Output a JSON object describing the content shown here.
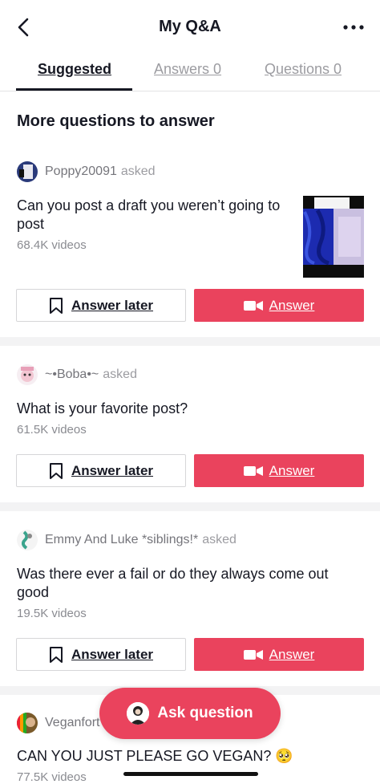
{
  "header": {
    "title": "My Q&A",
    "back_icon": "chevron-left-icon",
    "more_icon": "more-horizontal-icon"
  },
  "tabs": [
    {
      "label": "Suggested",
      "active": true
    },
    {
      "label": "Answers 0",
      "active": false
    },
    {
      "label": "Questions 0",
      "active": false
    }
  ],
  "section_title": "More questions to answer",
  "buttons": {
    "answer_later": "Answer later",
    "answer": "Answer"
  },
  "questions": [
    {
      "asker": "Poppy20091",
      "asked": "asked",
      "question": "Can you post a draft you weren’t going to post",
      "count": "68.4K videos"
    },
    {
      "asker": "~•Boba•~",
      "asked": "asked",
      "question": "What is your favorite post?",
      "count": "61.5K videos"
    },
    {
      "asker": "Emmy And Luke *siblings!*",
      "asked": "asked",
      "question": "Was there ever a fail or do they always come out good",
      "count": "19.5K videos"
    },
    {
      "asker": "Veganfort",
      "asked": "",
      "question": "CAN YOU JUST PLEASE GO VEGAN? 🥺",
      "count": "77.5K videos"
    }
  ],
  "fab": {
    "label": "Ask question"
  },
  "colors": {
    "accent": "#ea435d",
    "text": "#161823",
    "muted": "#8a8b91"
  }
}
